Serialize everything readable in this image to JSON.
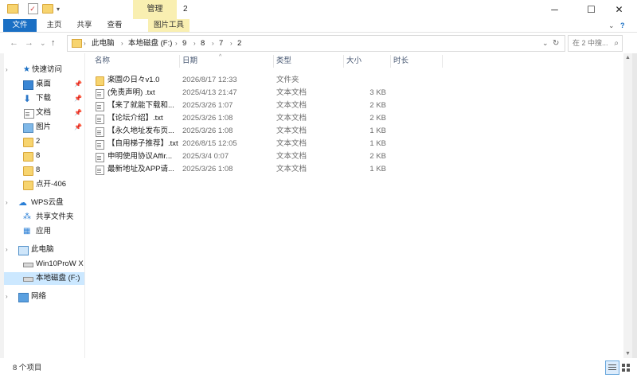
{
  "window": {
    "title": "2",
    "manage_tab": "管理",
    "controls": {
      "minimize": "─",
      "maximize": "☐",
      "close": "✕"
    }
  },
  "ribbon": {
    "tabs": [
      "文件",
      "主页",
      "共享",
      "查看",
      "图片工具"
    ],
    "accent_color": "#1a6fc4",
    "manage_color": "#f9efb1"
  },
  "nav": {
    "back": "←",
    "forward": "→",
    "recent": "⌄",
    "up": "↑",
    "breadcrumb": [
      "此电脑",
      "本地磁盘 (F:)",
      "9",
      "8",
      "7",
      "2"
    ],
    "search_placeholder": "在 2 中搜..."
  },
  "sidebar": {
    "quick_access": "快速访问",
    "items": [
      {
        "label": "桌面",
        "icon": "desktop-icon",
        "pinned": true
      },
      {
        "label": "下载",
        "icon": "download-icon",
        "pinned": true
      },
      {
        "label": "文档",
        "icon": "document-icon",
        "pinned": true
      },
      {
        "label": "图片",
        "icon": "picture-icon",
        "pinned": true
      },
      {
        "label": "2",
        "icon": "folder-icon"
      },
      {
        "label": "8",
        "icon": "folder-icon"
      },
      {
        "label": "8",
        "icon": "folder-icon"
      },
      {
        "label": "点开-406",
        "icon": "folder-icon"
      }
    ],
    "wps_cloud": "WPS云盘",
    "wps_items": [
      {
        "label": "共享文件夹",
        "icon": "share-icon"
      },
      {
        "label": "应用",
        "icon": "apps-icon"
      }
    ],
    "this_pc": "此电脑",
    "pc_items": [
      {
        "label": "Win10ProW X",
        "icon": "drive-icon"
      },
      {
        "label": "本地磁盘 (F:)",
        "icon": "drive-icon",
        "selected": true
      }
    ],
    "network": "网络"
  },
  "columns": {
    "name": "名称",
    "date": "日期",
    "type": "类型",
    "size": "大小",
    "duration": "时长"
  },
  "files": [
    {
      "name": "楽園の日々v1.0",
      "date": "2026/8/17 12:33",
      "type": "文件夹",
      "size": "",
      "icon": "folder"
    },
    {
      "name": "(免责声明) .txt",
      "date": "2025/4/13 21:47",
      "type": "文本文档",
      "size": "3 KB",
      "icon": "txt"
    },
    {
      "name": "【来了就能下载和...",
      "date": "2025/3/26 1:07",
      "type": "文本文档",
      "size": "2 KB",
      "icon": "txt"
    },
    {
      "name": "【论坛介绍】.txt",
      "date": "2025/3/26 1:08",
      "type": "文本文档",
      "size": "2 KB",
      "icon": "txt"
    },
    {
      "name": "【永久地址发布页...",
      "date": "2025/3/26 1:08",
      "type": "文本文档",
      "size": "1 KB",
      "icon": "txt"
    },
    {
      "name": "【自用梯子推荐】.txt",
      "date": "2026/8/15 12:05",
      "type": "文本文档",
      "size": "1 KB",
      "icon": "txt"
    },
    {
      "name": "申明使用协议Affir...",
      "date": "2025/3/4 0:07",
      "type": "文本文档",
      "size": "2 KB",
      "icon": "txt"
    },
    {
      "name": "最新地址及APP请...",
      "date": "2025/3/26 1:08",
      "type": "文本文档",
      "size": "1 KB",
      "icon": "txt"
    }
  ],
  "status": {
    "count_text": "8 个项目"
  }
}
